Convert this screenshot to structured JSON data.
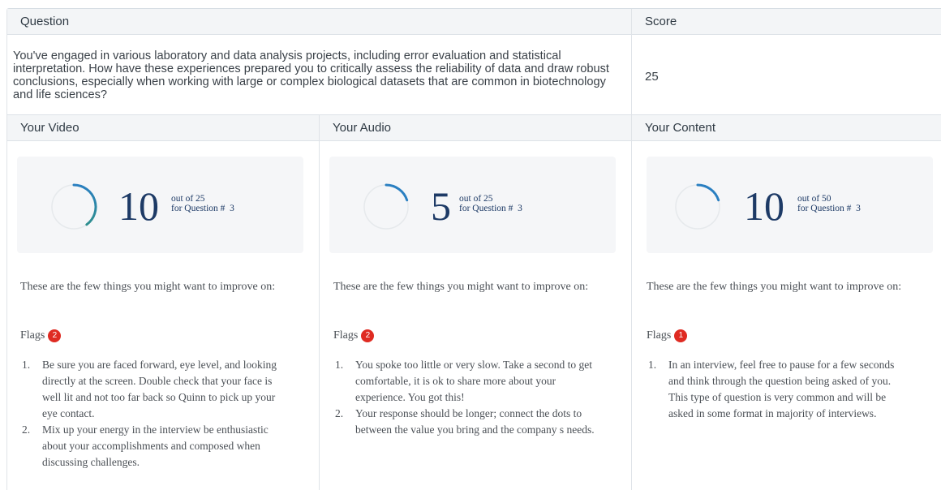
{
  "headers": {
    "question": "Question",
    "score": "Score",
    "video": "Your Video",
    "audio": "Your Audio",
    "content": "Your Content"
  },
  "question": {
    "text": "You've engaged in various laboratory and data analysis projects, including error evaluation and statistical interpretation. How have these experiences prepared you to critically assess the reliability of data and draw robust conclusions, especially when working with large or complex biological datasets that are common in biotechnology and life sciences?",
    "score": "25"
  },
  "columns": [
    {
      "score": "10",
      "out_of": "out of 25",
      "for_question": "for Question #  3",
      "fraction": 0.4,
      "ring_colors": [
        "#2a7fc1",
        "#2f8f8f"
      ],
      "improve_text": "These are the few things you might want to improve on:",
      "flags_label": "Flags",
      "flags_count": "2",
      "items": [
        "Be sure you are faced forward, eye level, and looking directly at the screen. Double check that your face is well lit and not too far back so Quinn to pick up your eye contact.",
        "Mix up your energy in the interview be enthusiastic about your accomplishments and composed when discussing challenges."
      ]
    },
    {
      "score": "5",
      "out_of": "out of 25",
      "for_question": "for Question #  3",
      "fraction": 0.2,
      "ring_colors": [
        "#2a7fc1",
        "#2a7fc1"
      ],
      "improve_text": "These are the few things you might want to improve on:",
      "flags_label": "Flags",
      "flags_count": "2",
      "items": [
        "You spoke too little or very slow. Take a second to get comfortable, it is ok to share more about your experience. You got this!",
        "Your response should be longer; connect the dots to between the value you bring and the company s needs."
      ]
    },
    {
      "score": "10",
      "out_of": "out of 50",
      "for_question": "for Question #  3",
      "fraction": 0.2,
      "ring_colors": [
        "#2a7fc1",
        "#2a7fc1"
      ],
      "improve_text": "These are the few things you might want to improve on:",
      "flags_label": "Flags",
      "flags_count": "1",
      "items": [
        "In an interview, feel free to pause for a few seconds and think through the question being asked of you. This type of question is very common and will be asked in some format in majority of interviews."
      ]
    }
  ]
}
